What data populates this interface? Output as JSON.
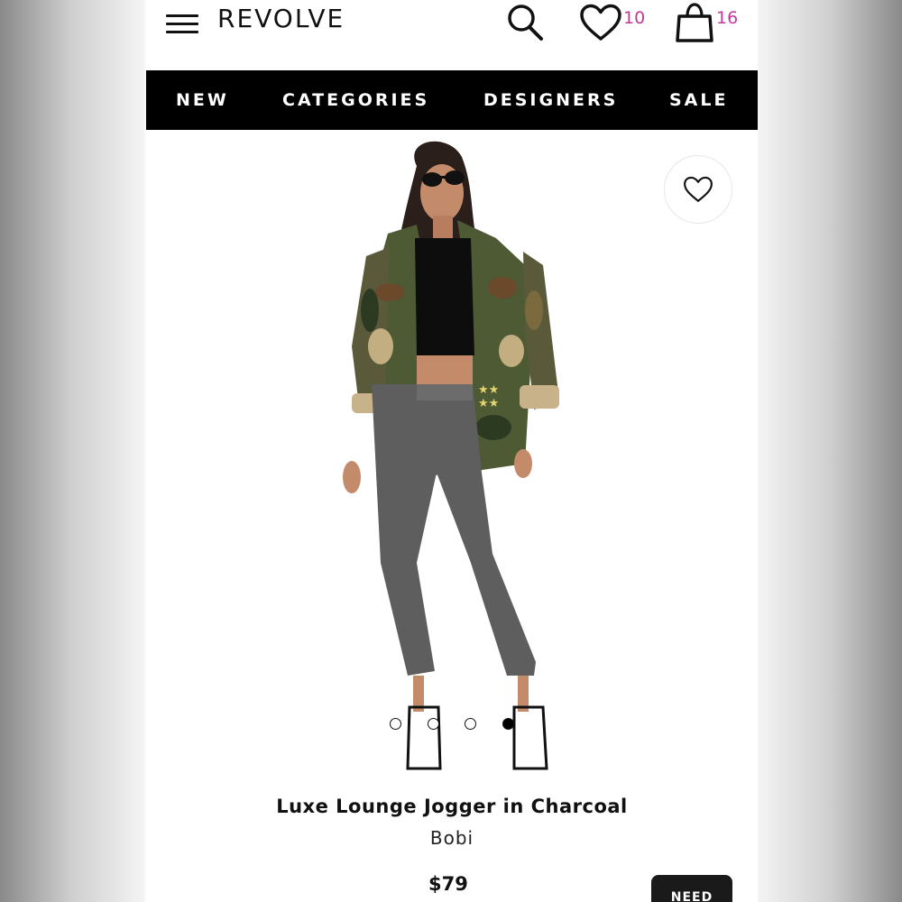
{
  "header": {
    "logo": "REVOLVE",
    "wishlist_count": "10",
    "bag_count": "16",
    "menu_icon": "hamburger-menu-icon",
    "search_icon": "search-icon",
    "wishlist_icon": "heart-icon",
    "bag_icon": "shopping-bag-icon",
    "badge_color": "#c23a99"
  },
  "nav": {
    "items": [
      {
        "label": "NEW"
      },
      {
        "label": "CATEGORIES"
      },
      {
        "label": "DESIGNERS"
      },
      {
        "label": "SALE"
      }
    ]
  },
  "product": {
    "title": "Luxe Lounge Jogger in Charcoal",
    "brand": "Bobi",
    "price": "$79",
    "image_count": 4,
    "active_image_index": 3,
    "cta_label": "NEED"
  }
}
